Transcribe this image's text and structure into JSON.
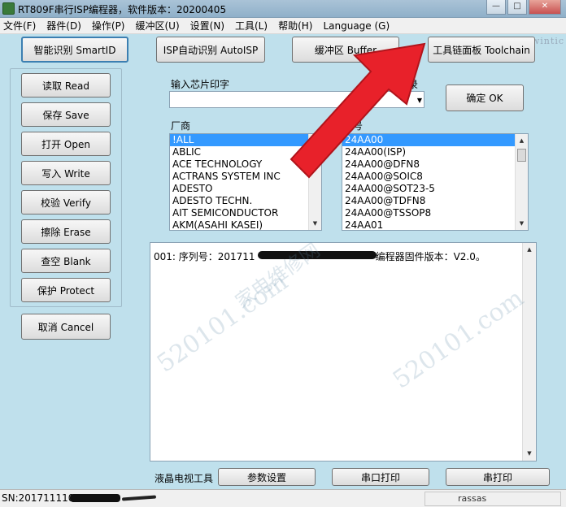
{
  "window": {
    "title": "RT809F串行ISP编程器，软件版本：20200405",
    "minimize_glyph": "—",
    "maximize_glyph": "□",
    "close_glyph": "✕"
  },
  "menu": [
    "文件(F)",
    "器件(D)",
    "操作(P)",
    "缓冲区(U)",
    "设置(N)",
    "工具(L)",
    "帮助(H)",
    "Language (G)"
  ],
  "top_buttons": {
    "smart_id": "智能识别 SmartID",
    "auto_isp": "ISP自动识别 AutoISP",
    "buffer": "缓冲区 Buffer",
    "toolchain": "工具链面板 Toolchain"
  },
  "watermark_url": "www.jawintic",
  "side_buttons": [
    "读取 Read",
    "保存 Save",
    "打开 Open",
    "写入 Write",
    "校验 Verify",
    "擦除 Erase",
    "查空 Blank",
    "保护 Protect"
  ],
  "cancel_button": "取消 Cancel",
  "panel": {
    "chip_label": "输入芯片印字",
    "record_label": "录",
    "chip_value": "",
    "ok_button": "确定 OK",
    "vendor_label": "厂商",
    "model_label": "型号"
  },
  "vendors": [
    "!ALL",
    "ABLIC",
    "ACE TECHNOLOGY",
    "ACTRANS SYSTEM INC",
    "ADESTO",
    "ADESTO TECHN.",
    "AIT SEMICONDUCTOR",
    "AKM(ASAHI KASEI)"
  ],
  "models": [
    "24AA00",
    "24AA00(ISP)",
    "24AA00@DFN8",
    "24AA00@SOIC8",
    "24AA00@SOT23-5",
    "24AA00@TDFN8",
    "24AA00@TSSOP8",
    "24AA01"
  ],
  "log": {
    "line1_prefix": "001: 序列号：201711",
    "line1_suffix": "编程器固件版本：V2.0。"
  },
  "bottom": {
    "lcd_tool_label": "液晶电视工具",
    "param_button": "参数设置",
    "serial_print_button": "串口打印",
    "extra_button": "串打印"
  },
  "status": {
    "sn_prefix": "SN:201711110",
    "right_cell": "rassas"
  },
  "watermarks": [
    "520101.com",
    "家电维修网"
  ],
  "colors": {
    "window_bg": "#bfe0ec",
    "selection": "#3399ff",
    "arrow": "#e8212a"
  }
}
